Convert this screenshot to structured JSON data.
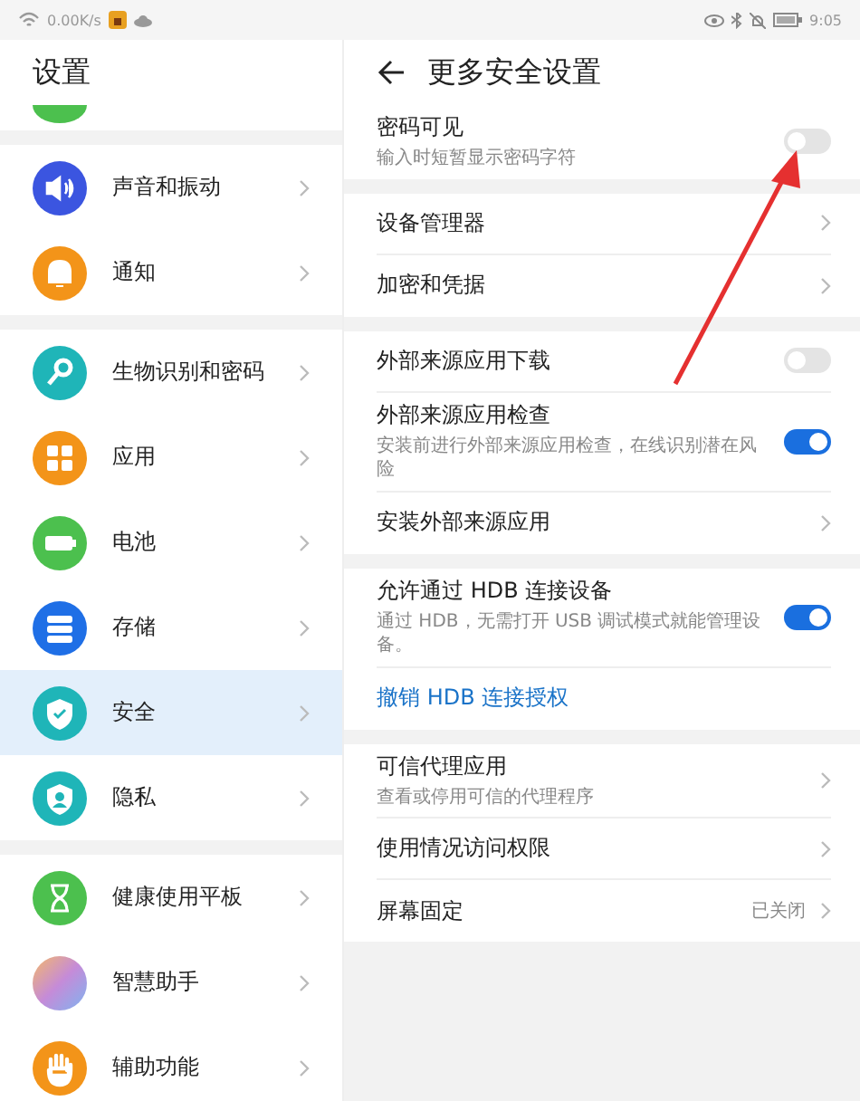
{
  "status_bar": {
    "speed": "0.00K/s",
    "time": "9:05"
  },
  "sidebar": {
    "title": "设置",
    "groups": [
      {
        "items": [
          {
            "label": "声音和振动",
            "kind": "sound",
            "color": "#3b55e0",
            "selected": false
          },
          {
            "label": "通知",
            "kind": "bell",
            "color": "#f39419",
            "selected": false
          }
        ]
      },
      {
        "items": [
          {
            "label": "生物识别和密码",
            "kind": "key",
            "color": "#1fb5b8",
            "selected": false
          },
          {
            "label": "应用",
            "kind": "grid",
            "color": "#f39419",
            "selected": false
          },
          {
            "label": "电池",
            "kind": "battery",
            "color": "#4cc04e",
            "selected": false
          },
          {
            "label": "存储",
            "kind": "storage",
            "color": "#1f6fe6",
            "selected": false
          },
          {
            "label": "安全",
            "kind": "shield",
            "color": "#1fb5b8",
            "selected": true
          },
          {
            "label": "隐私",
            "kind": "privacy",
            "color": "#1fb5b8",
            "selected": false
          }
        ]
      },
      {
        "items": [
          {
            "label": "健康使用平板",
            "kind": "hourglass",
            "color": "#4cc04e",
            "selected": false
          },
          {
            "label": "智慧助手",
            "kind": "gradient",
            "color": "#c58bd8",
            "selected": false
          },
          {
            "label": "辅助功能",
            "kind": "hand",
            "color": "#f39419",
            "selected": false
          }
        ]
      }
    ]
  },
  "page": {
    "title": "更多安全设置",
    "groups": [
      {
        "items": [
          {
            "kind": "toggle",
            "title": "密码可见",
            "subtitle": "输入时短暂显示密码字符",
            "on": false
          }
        ]
      },
      {
        "items": [
          {
            "kind": "link",
            "title": "设备管理器"
          },
          {
            "kind": "link",
            "title": "加密和凭据"
          }
        ]
      },
      {
        "items": [
          {
            "kind": "toggle",
            "title": "外部来源应用下载",
            "on": false
          },
          {
            "kind": "toggle",
            "title": "外部来源应用检查",
            "subtitle": "安装前进行外部来源应用检查，在线识别潜在风险",
            "on": true
          },
          {
            "kind": "link",
            "title": "安装外部来源应用"
          }
        ]
      },
      {
        "items": [
          {
            "kind": "toggle",
            "title": "允许通过 HDB 连接设备",
            "subtitle": "通过 HDB，无需打开 USB 调试模式就能管理设备。",
            "on": true
          },
          {
            "kind": "action",
            "title": "撤销 HDB 连接授权"
          }
        ]
      },
      {
        "items": [
          {
            "kind": "link",
            "title": "可信代理应用",
            "subtitle": "查看或停用可信的代理程序"
          },
          {
            "kind": "link",
            "title": "使用情况访问权限"
          },
          {
            "kind": "link",
            "title": "屏幕固定",
            "value": "已关闭"
          }
        ]
      }
    ]
  }
}
